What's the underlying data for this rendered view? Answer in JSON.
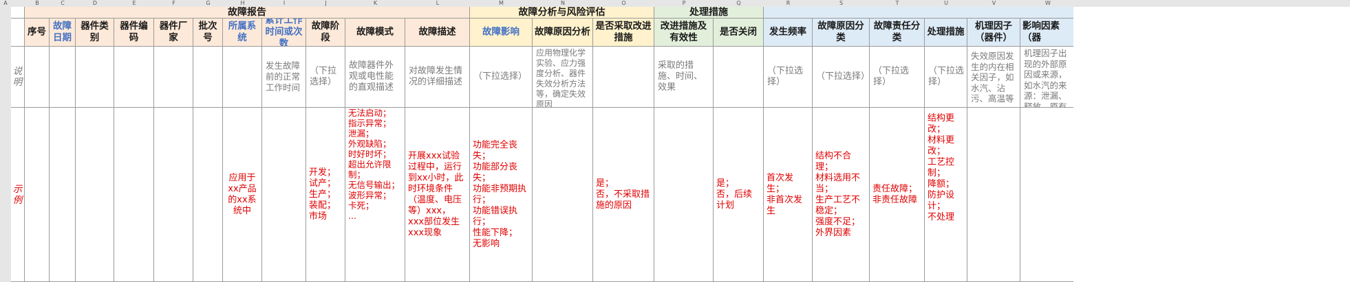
{
  "column_letters": [
    "A",
    "B",
    "C",
    "D",
    "E",
    "F",
    "G",
    "H",
    "I",
    "J",
    "K",
    "L",
    "M",
    "N",
    "O",
    "P",
    "Q",
    "R",
    "S",
    "T",
    "U",
    "V",
    "W"
  ],
  "groups": {
    "report": "故障报告",
    "analysis": "故障分析与风险评估",
    "measures": "处理措施"
  },
  "headers": {
    "seq": "序号",
    "date": "故障日期",
    "category": "器件类别",
    "code": "器件编码",
    "maker": "器件厂家",
    "batch": "批次号",
    "system": "所属系统",
    "work_time": "累计工作时间或次数",
    "phase": "故障阶段",
    "mode": "故障模式",
    "desc": "故障描述",
    "impact": "故障影响",
    "cause_analysis": "故障原因分析",
    "improve_yn": "是否采取改进措施",
    "improve_effect": "改进措施及有效性",
    "closed": "是否关闭",
    "freq": "发生频率",
    "cause_class": "故障原因分类",
    "resp_class": "故障责任分类",
    "handling": "处理措施",
    "mech_factor": "机理因子（器件）",
    "influence": "影响因素（器"
  },
  "rows": {
    "explain_label": "说明",
    "example_label": "示例"
  },
  "explain": {
    "work_time": "发生故障前的正常工作时间",
    "phase": "（下拉选择）",
    "mode": "故障器件外观或电性能的直观描述",
    "desc": "对故障发生情况的详细描述",
    "impact": "（下拉选择）",
    "cause_analysis": "应用物理化学实验、应力强度分析、器件失效分析方法等，确定失效原因",
    "improve_effect": "采取的措施、时间、效果",
    "freq": "（下拉选择）",
    "cause_class": "（下拉选择）",
    "resp_class": "（下拉选择）",
    "handling": "（下拉选择）",
    "mech_factor": "失效原因发生的内在相关因子，如水汽、沾污、高温等",
    "influence": "机理因子出现的外部原因或来源，如水汽的来源：泄漏、释放、原有等"
  },
  "example": {
    "system": "应用于xx产品的xx系统中",
    "phase": "开发；\n试产；\n生产；\n装配；\n市场",
    "mode": "无法启动；\n指示异常；\n泄漏；\n外观缺陷；\n时好时坏；\n超出允许限制；\n无信号输出；\n波形异常；\n卡死；\n...",
    "desc": "开展xxx试验过程中，运行到xx小时，此时环境条件（温度、电压等）xxx，xxx部位发生xxx现象",
    "impact": "功能完全丧失；\n功能部分丧失；\n功能非预期执行；\n功能错误执行；\n性能下降；\n无影响",
    "improve_yn": "是；\n否，不采取措施的原因",
    "closed": "是；\n否，后续计划",
    "freq": "首次发生；\n非首次发生",
    "cause_class": "结构不合理；\n材料选用不当；\n生产工艺不稳定；\n强度不足；\n外界因素",
    "resp_class": "责任故障；\n非责任故障",
    "handling": "结构更改；\n材料更改；\n工艺控制；\n降额；\n防护设计；\n不处理"
  },
  "colors": {
    "report_bg": "#fde9d9",
    "analysis_bg": "#fff2cc",
    "measures_bg": "#e2efda",
    "extra_bg": "#ddebf7",
    "note_text": "#7a7a7a",
    "example_text": "#e00000",
    "highlight_header": "#4472c4"
  }
}
